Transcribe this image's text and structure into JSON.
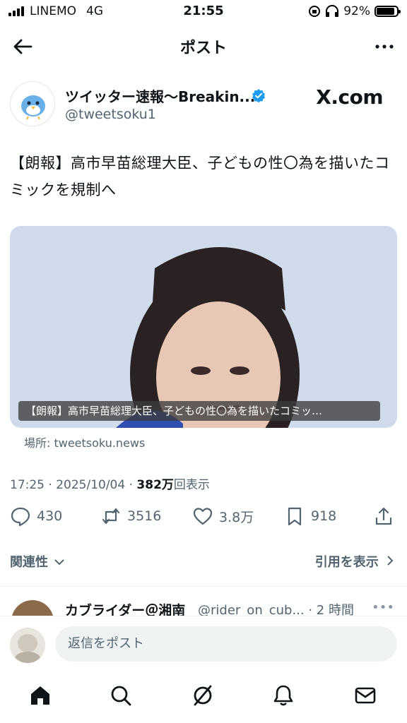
{
  "status_bar": {
    "carrier": "LINEMO",
    "network": "4G",
    "time": "21:55",
    "battery": "92%",
    "battery_level": 0.92
  },
  "header": {
    "title": "ポスト",
    "back_icon": "arrow-left-icon",
    "more_icon": "more-icon"
  },
  "author": {
    "name": "ツイッター速報〜Breakin...",
    "handle": "@tweetsoku1",
    "verified": true,
    "badge": "X.com"
  },
  "tweet": {
    "text": "【朗報】高市早苗総理大臣、子どもの性〇為を描いたコミックを規制へ",
    "card_caption": "【朗報】高市早苗総理大臣、子どもの性〇為を描いたコミッ…",
    "source": "場所: tweetsoku.news",
    "time": "17:25 · 2025/10/04 · ",
    "views_count": "382万",
    "views_label": "回表示"
  },
  "actions": {
    "replies": "430",
    "retweets": "3516",
    "likes": "3.8万",
    "bookmarks": "918"
  },
  "filters": {
    "relevance": "関連性",
    "quotes": "引用を表示"
  },
  "reply_preview": {
    "name": "カブライダー＠湘南",
    "handle": "@rider_on_cub... · 2 時間"
  },
  "composer": {
    "placeholder": "返信をポスト"
  },
  "colors": {
    "verified": "#1d9bf0",
    "text": "#0f1419",
    "muted": "#536471"
  }
}
